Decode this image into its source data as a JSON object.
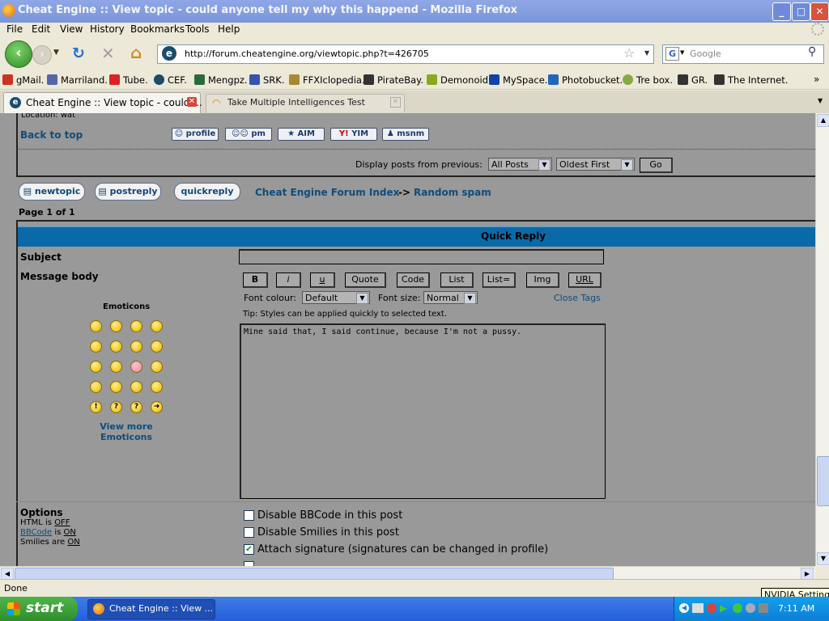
{
  "window": {
    "title": "Cheat Engine :: View topic - could anyone tell my why this happend - Mozilla Firefox",
    "controls": {
      "minimize": "_",
      "maximize": "□",
      "close": "✕"
    }
  },
  "menu": [
    "File",
    "Edit",
    "View",
    "History",
    "Bookmarks",
    "Tools",
    "Help"
  ],
  "nav": {
    "url": "http://forum.cheatengine.org/viewtopic.php?t=426705",
    "search_placeholder": "Google"
  },
  "bookmarks": [
    {
      "label": "gMail.",
      "color": "#cc3322"
    },
    {
      "label": "Marriland.",
      "color": "#5566aa"
    },
    {
      "label": "Tube.",
      "color": "#dd2222"
    },
    {
      "label": "CEF.",
      "color": "#1a4c6e"
    },
    {
      "label": "Mengpz.",
      "color": "#2a6a3a"
    },
    {
      "label": "SRK.",
      "color": "#3355aa"
    },
    {
      "label": "FFXIclopedia.",
      "color": "#aa8833"
    },
    {
      "label": "PirateBay.",
      "color": "#333333"
    },
    {
      "label": "Demonoid.",
      "color": "#88aa22"
    },
    {
      "label": "MySpace.",
      "color": "#1144aa"
    },
    {
      "label": "Photobucket.",
      "color": "#2266bb"
    },
    {
      "label": "Tre box.",
      "color": "#88aa44"
    },
    {
      "label": "GR.",
      "color": "#333333"
    },
    {
      "label": "The Internet.",
      "color": "#333333"
    }
  ],
  "tabs": [
    {
      "label": "Cheat Engine :: View topic - could ..."
    },
    {
      "label": "Take Multiple Intelligences Test"
    }
  ],
  "page": {
    "location_text": "Location: wat",
    "back_to_top": "Back to top",
    "profile_buttons": [
      "profile",
      "pm",
      "AIM",
      "YIM",
      "msnm"
    ],
    "display_label": "Display posts from previous:",
    "display_select": "All Posts",
    "order_select": "Oldest First",
    "go": "Go",
    "action_buttons": [
      "newtopic",
      "postreply",
      "quickreply"
    ],
    "breadcrumb_index": "Cheat Engine Forum Index",
    "breadcrumb_sep": "->",
    "breadcrumb_forum": "Random spam",
    "page_info": "Page 1 of 1",
    "quick_reply_title": "Quick Reply",
    "subject_label": "Subject",
    "message_label": "Message body",
    "emoticons_label": "Emoticons",
    "view_more": "View more Emoticons",
    "bbcode_buttons": [
      "B",
      "i",
      "u",
      "Quote",
      "Code",
      "List",
      "List=",
      "Img",
      "URL"
    ],
    "font_colour_label": "Font colour:",
    "font_colour_value": "Default",
    "font_size_label": "Font size:",
    "font_size_value": "Normal",
    "close_tags": "Close Tags",
    "tip": "Tip: Styles can be applied quickly to selected text.",
    "message_text": "Mine said that, I said continue, because I'm not a pussy.",
    "options_label": "Options",
    "html_is": "HTML is",
    "html_state": "OFF",
    "bbcode_link": "BBCode",
    "bbcode_is": "is",
    "bbcode_state": "ON",
    "smilies_are": "Smilies are",
    "smilies_state": "ON",
    "options": [
      {
        "label": "Disable BBCode in this post",
        "checked": false
      },
      {
        "label": "Disable Smilies in this post",
        "checked": false
      },
      {
        "label": "Attach signature (signatures can be changed in profile)",
        "checked": true
      }
    ]
  },
  "status": {
    "text": "Done",
    "tooltip": "NVIDIA Settings"
  },
  "taskbar": {
    "start": "start",
    "task": "Cheat Engine :: View ...",
    "clock": "7:11 AM"
  }
}
